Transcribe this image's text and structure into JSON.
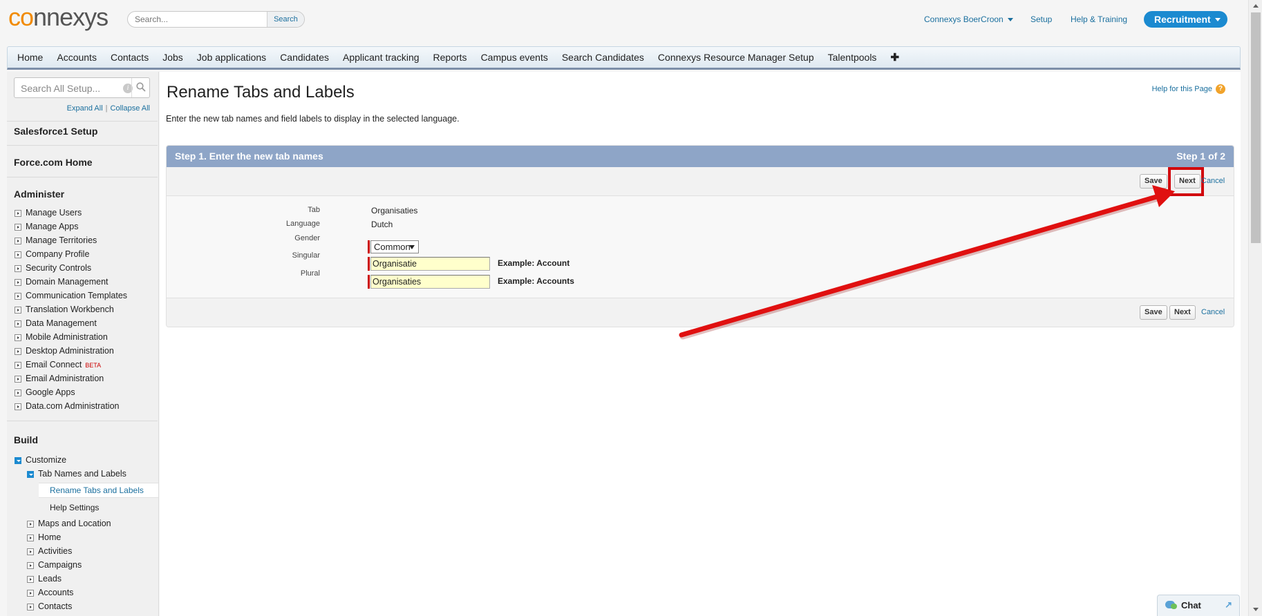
{
  "header": {
    "logo_prefix": "co",
    "logo_rest": "nnexys",
    "search_placeholder": "Search...",
    "search_button": "Search",
    "user_menu": "Connexys BoerCroon",
    "setup_link": "Setup",
    "help_training": "Help & Training",
    "app_menu": "Recruitment"
  },
  "tabs": [
    "Home",
    "Accounts",
    "Contacts",
    "Jobs",
    "Job applications",
    "Candidates",
    "Applicant tracking",
    "Reports",
    "Campus events",
    "Search Candidates",
    "Connexys Resource Manager Setup",
    "Talentpools"
  ],
  "tabs_more": "✚",
  "sidebar": {
    "search_placeholder": "Search All Setup...",
    "info_icon": "i",
    "expand_all": "Expand All",
    "separator": "|",
    "collapse_all": "Collapse All",
    "salesforce1": "Salesforce1 Setup",
    "forcecom": "Force.com Home",
    "administer_title": "Administer",
    "administer_items": [
      "Manage Users",
      "Manage Apps",
      "Manage Territories",
      "Company Profile",
      "Security Controls",
      "Domain Management",
      "Communication Templates",
      "Translation Workbench",
      "Data Management",
      "Mobile Administration",
      "Desktop Administration",
      "Email Connect",
      "Email Administration",
      "Google Apps",
      "Data.com Administration"
    ],
    "beta_badge": "BETA",
    "build_title": "Build",
    "customize": "Customize",
    "tab_names_labels": "Tab Names and Labels",
    "rename_tabs": "Rename Tabs and Labels",
    "help_settings": "Help Settings",
    "customize_items": [
      "Maps and Location",
      "Home",
      "Activities",
      "Campaigns",
      "Leads",
      "Accounts",
      "Contacts"
    ]
  },
  "main": {
    "title": "Rename Tabs and Labels",
    "help_link": "Help for this Page",
    "help_icon": "?",
    "description": "Enter the new tab names and field labels to display in the selected language.",
    "step_title": "Step 1. Enter the new tab names",
    "step_count": "Step 1 of 2",
    "save": "Save",
    "next": "Next",
    "cancel": "Cancel",
    "fields": {
      "tab_label": "Tab",
      "tab_value": "Organisaties",
      "language_label": "Language",
      "language_value": "Dutch",
      "gender_label": "Gender",
      "gender_value": "Common",
      "singular_label": "Singular",
      "singular_value": "Organisatie",
      "singular_example": "Example: Account",
      "plural_label": "Plural",
      "plural_value": "Organisaties",
      "plural_example": "Example: Accounts"
    }
  },
  "chat": {
    "label": "Chat",
    "popout_icon": "↗"
  },
  "annotation_color": "#d1060c"
}
